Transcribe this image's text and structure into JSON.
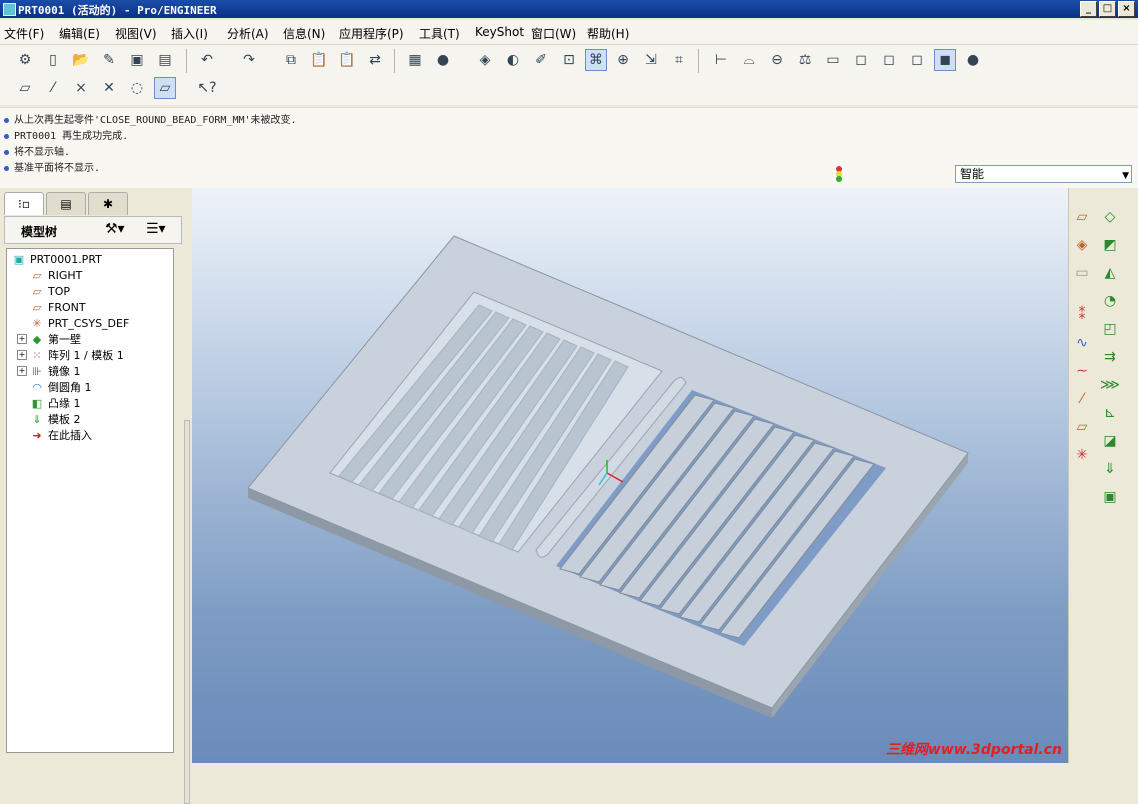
{
  "window": {
    "title": "PRT0001 (活动的) - Pro/ENGINEER",
    "minimize": "_",
    "maximize": "□",
    "close": "×"
  },
  "menu": [
    "文件(F)",
    "编辑(E)",
    "视图(V)",
    "插入(I)",
    "分析(A)",
    "信息(N)",
    "应用程序(P)",
    "工具(T)",
    "KeyShot",
    "窗口(W)",
    "帮助(H)"
  ],
  "messages": [
    "从上次再生起零件'CLOSE_ROUND_BEAD_FORM_MM'未被改变.",
    "PRT0001 再生成功完成.",
    "将不显示轴.",
    "基准平面将不显示."
  ],
  "filter": {
    "value": "智能"
  },
  "model_tree": {
    "header": "模型树",
    "items": [
      {
        "label": "PRT0001.PRT",
        "icon": "part-icon"
      },
      {
        "label": "RIGHT",
        "icon": "datum-plane-icon"
      },
      {
        "label": "TOP",
        "icon": "datum-plane-icon"
      },
      {
        "label": "FRONT",
        "icon": "datum-plane-icon"
      },
      {
        "label": "PRT_CSYS_DEF",
        "icon": "csys-icon"
      },
      {
        "label": "第一壁",
        "icon": "sheetmetal-wall-icon"
      },
      {
        "label": "阵列 1 / 模板 1",
        "icon": "pattern-icon"
      },
      {
        "label": "镜像 1",
        "icon": "mirror-icon"
      },
      {
        "label": "倒圆角 1",
        "icon": "round-icon"
      },
      {
        "label": "凸缘 1",
        "icon": "flange-icon"
      },
      {
        "label": "模板 2",
        "icon": "form-icon"
      },
      {
        "label": "在此插入",
        "icon": "insert-here-arrow-icon"
      }
    ]
  },
  "watermark": "三维网www.3dportal.cn",
  "colors": {
    "titlebar": "#0a2f86",
    "viewport_top": "#eef3f9",
    "viewport_bottom": "#6a8bbb",
    "part": "#c9d2dc"
  }
}
